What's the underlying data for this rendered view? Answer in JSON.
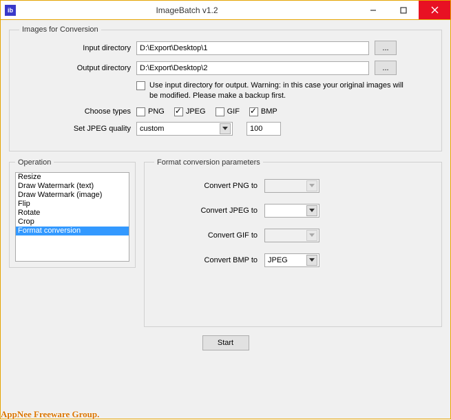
{
  "window": {
    "title": "ImageBatch v1.2",
    "icon_text": "ib"
  },
  "images_box": {
    "legend": "Images for Conversion",
    "input_dir_label": "Input directory",
    "input_dir": "D:\\Export\\Desktop\\1",
    "output_dir_label": "Output directory",
    "output_dir": "D:\\Export\\Desktop\\2",
    "browse_label": "...",
    "same_dir_msg": "Use input directory for output. Warning: in this case your original images will be modified. Please make a backup first.",
    "choose_types_label": "Choose types",
    "type_png": "PNG",
    "type_jpeg": "JPEG",
    "type_gif": "GIF",
    "type_bmp": "BMP",
    "jpeg_quality_label": "Set JPEG quality",
    "jpeg_quality_mode": "custom",
    "jpeg_quality_value": "100"
  },
  "operation_box": {
    "legend": "Operation",
    "items": [
      "Resize",
      "Draw Watermark (text)",
      "Draw Watermark (image)",
      "Flip",
      "Rotate",
      "Crop",
      "Format conversion"
    ]
  },
  "params_box": {
    "legend": "Format conversion parameters",
    "rows": [
      {
        "label": "Convert PNG to",
        "value": "",
        "enabled": false
      },
      {
        "label": "Convert JPEG to",
        "value": "",
        "enabled": true
      },
      {
        "label": "Convert GIF to",
        "value": "",
        "enabled": false
      },
      {
        "label": "Convert BMP to",
        "value": "JPEG",
        "enabled": true
      }
    ]
  },
  "start_label": "Start",
  "watermark": "AppNee Freeware Group."
}
